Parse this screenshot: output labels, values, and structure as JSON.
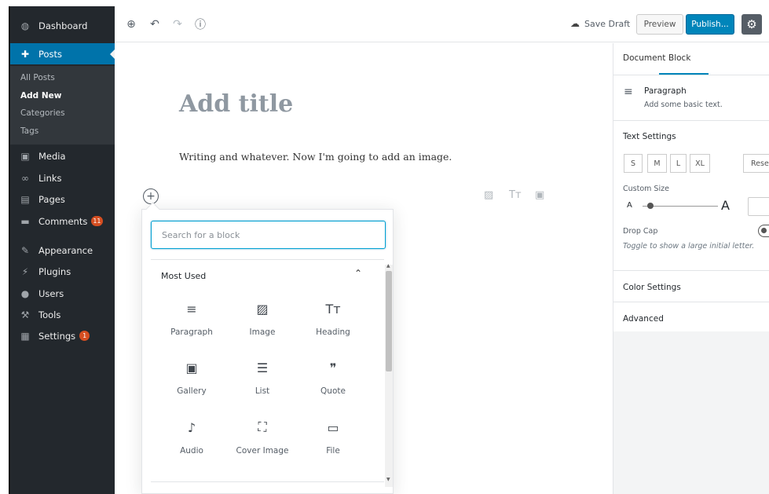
{
  "sidebar": {
    "items": [
      {
        "label": "Dashboard",
        "icon": "dashboard-icon",
        "glyph": "◍"
      },
      {
        "label": "Posts",
        "icon": "pin-icon",
        "glyph": "✚"
      },
      {
        "label": "Media",
        "icon": "media-icon",
        "glyph": "▣"
      },
      {
        "label": "Links",
        "icon": "link-icon",
        "glyph": "∞"
      },
      {
        "label": "Pages",
        "icon": "pages-icon",
        "glyph": "▤"
      },
      {
        "label": "Comments",
        "icon": "comment-icon",
        "glyph": "▬",
        "badge": "11"
      },
      {
        "label": "Appearance",
        "icon": "appearance-icon",
        "glyph": "✎"
      },
      {
        "label": "Plugins",
        "icon": "plugin-icon",
        "glyph": "⚡"
      },
      {
        "label": "Users",
        "icon": "users-icon",
        "glyph": "●"
      },
      {
        "label": "Tools",
        "icon": "tools-icon",
        "glyph": "⚒"
      },
      {
        "label": "Settings",
        "icon": "settings-icon",
        "glyph": "▦",
        "badge": "1"
      }
    ],
    "posts_submenu": [
      "All Posts",
      "Add New",
      "Categories",
      "Tags"
    ]
  },
  "toolbar": {
    "add_block_icon": "⊕",
    "undo_icon": "↶",
    "redo_icon": "↷",
    "info_icon": "ⓘ",
    "save_draft_icon": "☁",
    "save_draft": "Save Draft",
    "preview": "Preview",
    "publish": "Publish...",
    "settings_icon": "⚙"
  },
  "editor": {
    "title_placeholder": "Add title",
    "paragraph": "Writing and whatever. Now I'm going to add an image.",
    "inserter_icon": "+",
    "quick_icons": [
      "▨",
      "Tт",
      "▣"
    ]
  },
  "inserter": {
    "search_placeholder": "Search for a block",
    "section_title": "Most Used",
    "collapse_icon": "⌃",
    "blocks": [
      {
        "label": "Paragraph",
        "icon": "paragraph-icon",
        "glyph": "≡"
      },
      {
        "label": "Image",
        "icon": "image-icon",
        "glyph": "▨"
      },
      {
        "label": "Heading",
        "icon": "heading-icon",
        "glyph": "Tт"
      },
      {
        "label": "Gallery",
        "icon": "gallery-icon",
        "glyph": "▣"
      },
      {
        "label": "List",
        "icon": "list-icon",
        "glyph": "☰"
      },
      {
        "label": "Quote",
        "icon": "quote-icon",
        "glyph": "❞"
      },
      {
        "label": "Audio",
        "icon": "audio-icon",
        "glyph": "♪"
      },
      {
        "label": "Cover Image",
        "icon": "cover-image-icon",
        "glyph": "⛶"
      },
      {
        "label": "File",
        "icon": "folder-icon",
        "glyph": "▭"
      }
    ]
  },
  "settings": {
    "tabs": [
      "Document",
      "Block"
    ],
    "block_icon": "≡",
    "block_name": "Paragraph",
    "block_desc": "Add some basic text.",
    "text_settings": "Text Settings",
    "sizes": [
      "S",
      "M",
      "L",
      "XL"
    ],
    "reset": "Reset",
    "custom_size": "Custom Size",
    "slider_min_label": "A",
    "slider_max_label": "A",
    "drop_cap": "Drop Cap",
    "drop_cap_help": "Toggle to show a large initial letter.",
    "color_settings": "Color Settings",
    "advanced": "Advanced"
  }
}
